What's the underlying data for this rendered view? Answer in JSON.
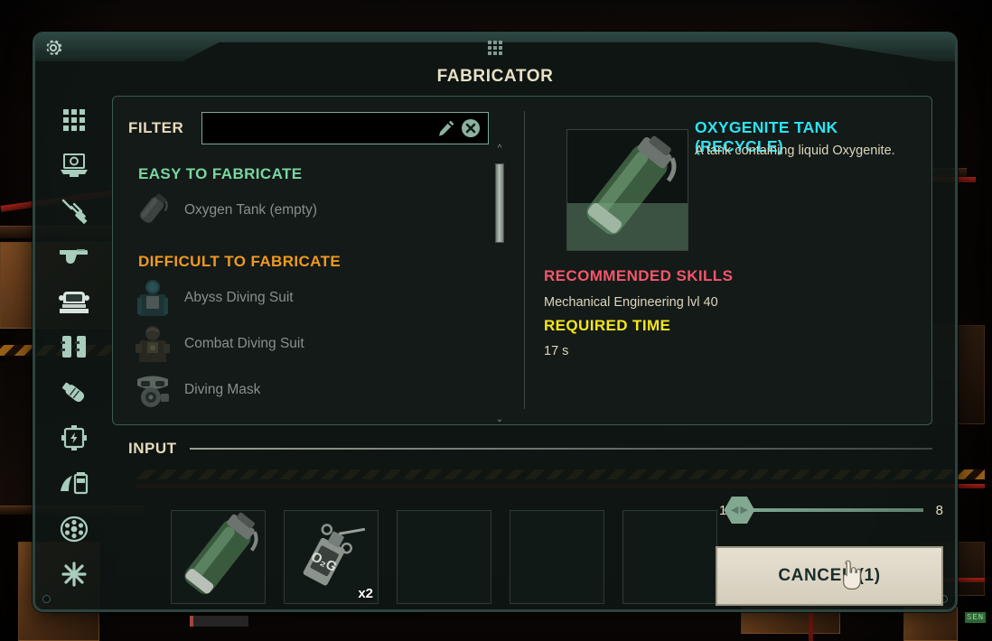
{
  "window": {
    "title": "FABRICATOR",
    "gear_icon": "gear-icon",
    "drag_handle_icon": "drag-handle-icon"
  },
  "sidebar": {
    "items": [
      {
        "icon": "grid-all-items-icon",
        "name": "category-all"
      },
      {
        "icon": "electrical-device-icon",
        "name": "category-electrical"
      },
      {
        "icon": "syringe-medical-icon",
        "name": "category-medical"
      },
      {
        "icon": "pistol-weapon-icon",
        "name": "category-weapons"
      },
      {
        "icon": "diving-helmet-icon",
        "name": "category-diving"
      },
      {
        "icon": "ammo-canisters-icon",
        "name": "category-ammunition"
      },
      {
        "icon": "tank-bottle-icon",
        "name": "category-tanks"
      },
      {
        "icon": "battery-power-icon",
        "name": "category-power"
      },
      {
        "icon": "plant-jar-icon",
        "name": "category-botany"
      },
      {
        "icon": "wheel-valve-icon",
        "name": "category-machine-parts"
      },
      {
        "icon": "asterisk-misc-icon",
        "name": "category-misc"
      }
    ]
  },
  "filter": {
    "label": "FILTER",
    "value": "",
    "placeholder": "",
    "pencil_icon": "pencil-icon",
    "clear_icon": "clear-circle-x-icon"
  },
  "recipes": {
    "categories": [
      {
        "heading": "EASY TO FABRICATE",
        "color": "#7ad6a0",
        "items": [
          {
            "label": "Oxygen Tank (empty)",
            "icon": "oxygen-tank-icon"
          }
        ]
      },
      {
        "heading": "DIFFICULT TO FABRICATE",
        "color": "#f09a1e",
        "items": [
          {
            "label": "Abyss Diving Suit",
            "icon": "abyss-diving-suit-icon"
          },
          {
            "label": "Combat Diving Suit",
            "icon": "combat-diving-suit-icon"
          },
          {
            "label": "Diving Mask",
            "icon": "diving-mask-icon"
          }
        ]
      }
    ],
    "scroll_up_caret": "chevron-up-icon",
    "scroll_down_caret": "chevron-down-icon"
  },
  "detail": {
    "item_name": "OXYGENITE TANK (RECYCLE)",
    "item_description": "A tank containing liquid Oxygenite.",
    "preview_icon": "oxygenite-tank-icon",
    "skills_heading": "RECOMMENDED SKILLS",
    "skills_text": "Mechanical Engineering lvl 40",
    "time_heading": "REQUIRED TIME",
    "time_text": "17 s"
  },
  "input": {
    "label": "INPUT",
    "slots": [
      {
        "icon": "oxygenite-tank-icon",
        "count": "",
        "condition": "low"
      },
      {
        "icon": "oxygen-generator-icon",
        "count": "x2",
        "condition": ""
      },
      {
        "icon": "",
        "count": "",
        "condition": ""
      },
      {
        "icon": "",
        "count": "",
        "condition": ""
      },
      {
        "icon": "",
        "count": "",
        "condition": ""
      }
    ]
  },
  "amount": {
    "min": "1",
    "max": "8",
    "value": "1",
    "knob_icon": "left-right-arrows-icon"
  },
  "action": {
    "cancel_label": "CANCEL (1)"
  },
  "cursor": {
    "icon": "hand-pointer-cursor"
  },
  "colors": {
    "accent_cyan": "#2be3f0",
    "accent_green": "#7ad6a0",
    "accent_orange": "#f09a1e",
    "accent_red": "#f4566a",
    "accent_yellow": "#f5e518",
    "text_cream": "#e6dcbb",
    "frame": "#2c4440"
  }
}
